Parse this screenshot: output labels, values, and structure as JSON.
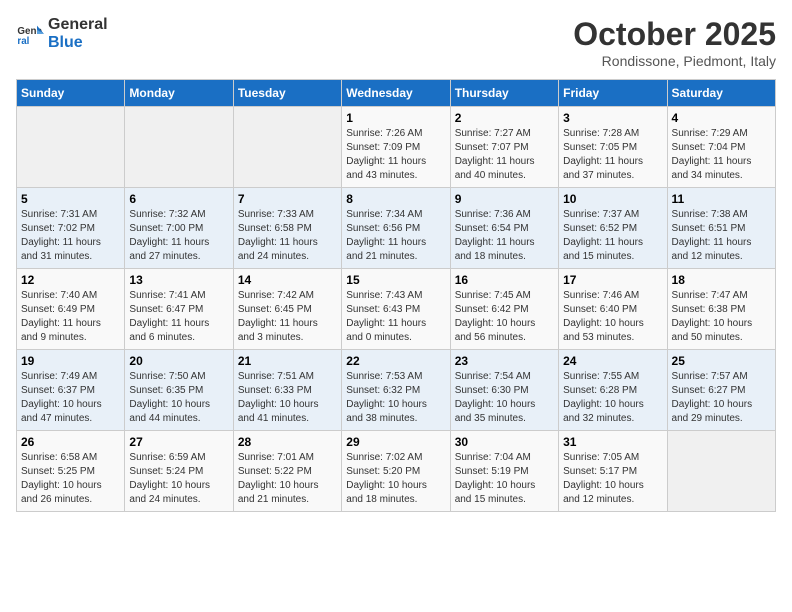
{
  "header": {
    "logo_line1": "General",
    "logo_line2": "Blue",
    "month": "October 2025",
    "location": "Rondissone, Piedmont, Italy"
  },
  "weekdays": [
    "Sunday",
    "Monday",
    "Tuesday",
    "Wednesday",
    "Thursday",
    "Friday",
    "Saturday"
  ],
  "weeks": [
    [
      {
        "day": "",
        "info": ""
      },
      {
        "day": "",
        "info": ""
      },
      {
        "day": "",
        "info": ""
      },
      {
        "day": "1",
        "info": "Sunrise: 7:26 AM\nSunset: 7:09 PM\nDaylight: 11 hours\nand 43 minutes."
      },
      {
        "day": "2",
        "info": "Sunrise: 7:27 AM\nSunset: 7:07 PM\nDaylight: 11 hours\nand 40 minutes."
      },
      {
        "day": "3",
        "info": "Sunrise: 7:28 AM\nSunset: 7:05 PM\nDaylight: 11 hours\nand 37 minutes."
      },
      {
        "day": "4",
        "info": "Sunrise: 7:29 AM\nSunset: 7:04 PM\nDaylight: 11 hours\nand 34 minutes."
      }
    ],
    [
      {
        "day": "5",
        "info": "Sunrise: 7:31 AM\nSunset: 7:02 PM\nDaylight: 11 hours\nand 31 minutes."
      },
      {
        "day": "6",
        "info": "Sunrise: 7:32 AM\nSunset: 7:00 PM\nDaylight: 11 hours\nand 27 minutes."
      },
      {
        "day": "7",
        "info": "Sunrise: 7:33 AM\nSunset: 6:58 PM\nDaylight: 11 hours\nand 24 minutes."
      },
      {
        "day": "8",
        "info": "Sunrise: 7:34 AM\nSunset: 6:56 PM\nDaylight: 11 hours\nand 21 minutes."
      },
      {
        "day": "9",
        "info": "Sunrise: 7:36 AM\nSunset: 6:54 PM\nDaylight: 11 hours\nand 18 minutes."
      },
      {
        "day": "10",
        "info": "Sunrise: 7:37 AM\nSunset: 6:52 PM\nDaylight: 11 hours\nand 15 minutes."
      },
      {
        "day": "11",
        "info": "Sunrise: 7:38 AM\nSunset: 6:51 PM\nDaylight: 11 hours\nand 12 minutes."
      }
    ],
    [
      {
        "day": "12",
        "info": "Sunrise: 7:40 AM\nSunset: 6:49 PM\nDaylight: 11 hours\nand 9 minutes."
      },
      {
        "day": "13",
        "info": "Sunrise: 7:41 AM\nSunset: 6:47 PM\nDaylight: 11 hours\nand 6 minutes."
      },
      {
        "day": "14",
        "info": "Sunrise: 7:42 AM\nSunset: 6:45 PM\nDaylight: 11 hours\nand 3 minutes."
      },
      {
        "day": "15",
        "info": "Sunrise: 7:43 AM\nSunset: 6:43 PM\nDaylight: 11 hours\nand 0 minutes."
      },
      {
        "day": "16",
        "info": "Sunrise: 7:45 AM\nSunset: 6:42 PM\nDaylight: 10 hours\nand 56 minutes."
      },
      {
        "day": "17",
        "info": "Sunrise: 7:46 AM\nSunset: 6:40 PM\nDaylight: 10 hours\nand 53 minutes."
      },
      {
        "day": "18",
        "info": "Sunrise: 7:47 AM\nSunset: 6:38 PM\nDaylight: 10 hours\nand 50 minutes."
      }
    ],
    [
      {
        "day": "19",
        "info": "Sunrise: 7:49 AM\nSunset: 6:37 PM\nDaylight: 10 hours\nand 47 minutes."
      },
      {
        "day": "20",
        "info": "Sunrise: 7:50 AM\nSunset: 6:35 PM\nDaylight: 10 hours\nand 44 minutes."
      },
      {
        "day": "21",
        "info": "Sunrise: 7:51 AM\nSunset: 6:33 PM\nDaylight: 10 hours\nand 41 minutes."
      },
      {
        "day": "22",
        "info": "Sunrise: 7:53 AM\nSunset: 6:32 PM\nDaylight: 10 hours\nand 38 minutes."
      },
      {
        "day": "23",
        "info": "Sunrise: 7:54 AM\nSunset: 6:30 PM\nDaylight: 10 hours\nand 35 minutes."
      },
      {
        "day": "24",
        "info": "Sunrise: 7:55 AM\nSunset: 6:28 PM\nDaylight: 10 hours\nand 32 minutes."
      },
      {
        "day": "25",
        "info": "Sunrise: 7:57 AM\nSunset: 6:27 PM\nDaylight: 10 hours\nand 29 minutes."
      }
    ],
    [
      {
        "day": "26",
        "info": "Sunrise: 6:58 AM\nSunset: 5:25 PM\nDaylight: 10 hours\nand 26 minutes."
      },
      {
        "day": "27",
        "info": "Sunrise: 6:59 AM\nSunset: 5:24 PM\nDaylight: 10 hours\nand 24 minutes."
      },
      {
        "day": "28",
        "info": "Sunrise: 7:01 AM\nSunset: 5:22 PM\nDaylight: 10 hours\nand 21 minutes."
      },
      {
        "day": "29",
        "info": "Sunrise: 7:02 AM\nSunset: 5:20 PM\nDaylight: 10 hours\nand 18 minutes."
      },
      {
        "day": "30",
        "info": "Sunrise: 7:04 AM\nSunset: 5:19 PM\nDaylight: 10 hours\nand 15 minutes."
      },
      {
        "day": "31",
        "info": "Sunrise: 7:05 AM\nSunset: 5:17 PM\nDaylight: 10 hours\nand 12 minutes."
      },
      {
        "day": "",
        "info": ""
      }
    ]
  ]
}
